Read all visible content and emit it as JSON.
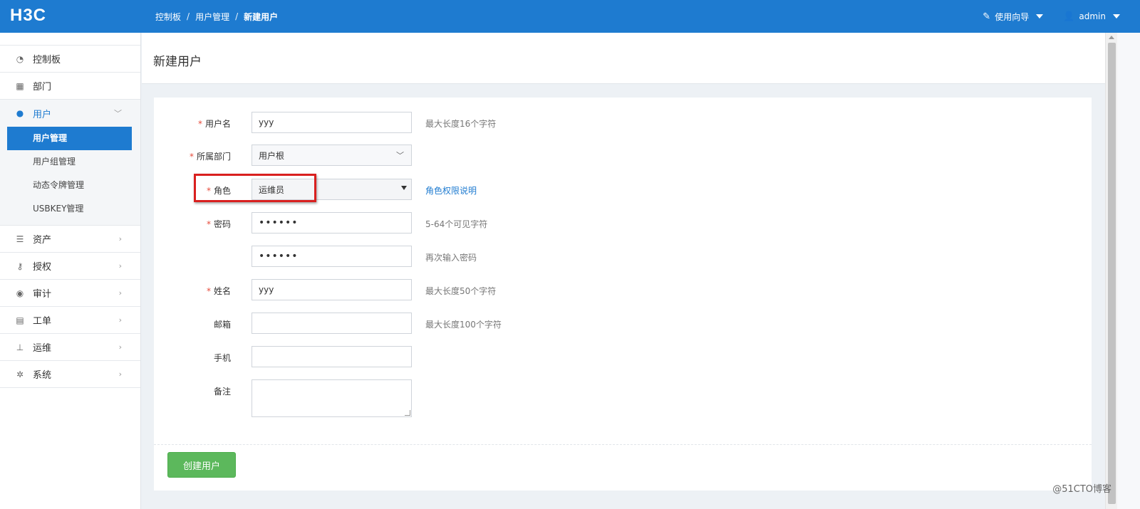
{
  "header": {
    "logo": "H3C",
    "breadcrumb": [
      "控制板",
      "用户管理",
      "新建用户"
    ],
    "guide_label": "使用向导",
    "user_label": "admin"
  },
  "sidebar": {
    "items": [
      {
        "label": "控制板",
        "icon": "dashboard-icon"
      },
      {
        "label": "部门",
        "icon": "grid-icon"
      },
      {
        "label": "用户",
        "icon": "user-icon"
      },
      {
        "label": "资产",
        "icon": "list-icon"
      },
      {
        "label": "授权",
        "icon": "key-icon"
      },
      {
        "label": "审计",
        "icon": "eye-icon"
      },
      {
        "label": "工单",
        "icon": "document-icon"
      },
      {
        "label": "运维",
        "icon": "sitemap-icon"
      },
      {
        "label": "系统",
        "icon": "gear-icon"
      }
    ],
    "user_sub": [
      "用户管理",
      "用户组管理",
      "动态令牌管理",
      "USBKEY管理"
    ]
  },
  "page": {
    "title": "新建用户"
  },
  "form": {
    "username": {
      "label": "用户名",
      "value": "yyy",
      "hint": "最大长度16个字符"
    },
    "department": {
      "label": "所属部门",
      "value": "用户根"
    },
    "role": {
      "label": "角色",
      "value": "运维员",
      "hint": "角色权限说明"
    },
    "password": {
      "label": "密码",
      "value": "••••••",
      "hint": "5-64个可见字符"
    },
    "password_confirm": {
      "value": "••••••",
      "hint": "再次输入密码"
    },
    "name": {
      "label": "姓名",
      "value": "yyy",
      "hint": "最大长度50个字符"
    },
    "email": {
      "label": "邮箱",
      "value": "",
      "hint": "最大长度100个字符"
    },
    "phone": {
      "label": "手机",
      "value": ""
    },
    "note": {
      "label": "备注",
      "value": ""
    },
    "submit_label": "创建用户"
  },
  "watermark": "@51CTO博客",
  "colors": {
    "primary": "#1e7bd0",
    "success": "#5cb85c",
    "required": "#e74c3c",
    "highlight": "#d9201f"
  }
}
